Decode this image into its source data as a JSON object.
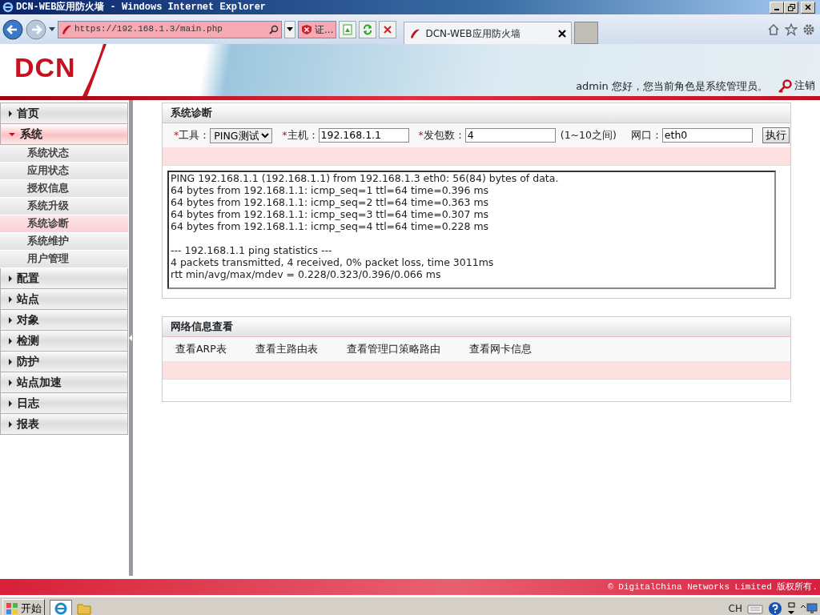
{
  "window": {
    "title": "DCN-WEB应用防火墙 - Windows Internet Explorer"
  },
  "browser": {
    "address": "https://192.168.1.3/main.php",
    "cert_label": "证...",
    "tab_title": "DCN-WEB应用防火墙"
  },
  "header": {
    "logo": "DCN",
    "greeting": "admin 您好，您当前角色是系统管理员。",
    "logout": "注销"
  },
  "sidebar": {
    "items": [
      {
        "label": "首页",
        "expanded": false
      },
      {
        "label": "系统",
        "expanded": true,
        "children": [
          {
            "label": "系统状态",
            "selected": false
          },
          {
            "label": "应用状态",
            "selected": false
          },
          {
            "label": "授权信息",
            "selected": false
          },
          {
            "label": "系统升级",
            "selected": false
          },
          {
            "label": "系统诊断",
            "selected": true
          },
          {
            "label": "系统维护",
            "selected": false
          },
          {
            "label": "用户管理",
            "selected": false
          }
        ]
      },
      {
        "label": "配置",
        "expanded": false
      },
      {
        "label": "站点",
        "expanded": false
      },
      {
        "label": "对象",
        "expanded": false
      },
      {
        "label": "检测",
        "expanded": false
      },
      {
        "label": "防护",
        "expanded": false
      },
      {
        "label": "站点加速",
        "expanded": false
      },
      {
        "label": "日志",
        "expanded": false
      },
      {
        "label": "报表",
        "expanded": false
      }
    ]
  },
  "diagnosis": {
    "title": "系统诊断",
    "fields": [
      {
        "kind": "select",
        "mark": "*",
        "label": "工具：",
        "value": "PING测试"
      },
      {
        "kind": "text",
        "mark": "*",
        "label": "主机：",
        "value": "192.168.1.1"
      },
      {
        "kind": "text",
        "mark": "*",
        "label": "发包数：",
        "value": "4",
        "hint": "(1~10之间)"
      },
      {
        "kind": "text",
        "label": "网口：",
        "value": "eth0"
      }
    ],
    "button": "执行",
    "output": "PING 192.168.1.1 (192.168.1.1) from 192.168.1.3 eth0: 56(84) bytes of data.\n64 bytes from 192.168.1.1: icmp_seq=1 ttl=64 time=0.396 ms\n64 bytes from 192.168.1.1: icmp_seq=2 ttl=64 time=0.363 ms\n64 bytes from 192.168.1.1: icmp_seq=3 ttl=64 time=0.307 ms\n64 bytes from 192.168.1.1: icmp_seq=4 ttl=64 time=0.228 ms\n\n--- 192.168.1.1 ping statistics ---\n4 packets transmitted, 4 received, 0% packet loss, time 3011ms\nrtt min/avg/max/mdev = 0.228/0.323/0.396/0.066 ms"
  },
  "network_info": {
    "title": "网络信息查看",
    "links": [
      "查看ARP表",
      "查看主路由表",
      "查看管理口策略路由",
      "查看网卡信息"
    ]
  },
  "footer": {
    "copyright": "© DigitalChina Networks Limited 版权所有."
  },
  "taskbar": {
    "start": "开始",
    "language": "CH"
  }
}
